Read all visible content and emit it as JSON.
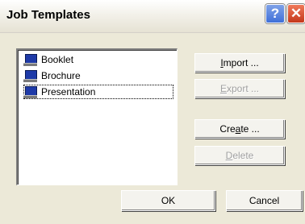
{
  "window": {
    "title": "Job Templates",
    "help_label": "?",
    "close_label": "✕"
  },
  "templates": [
    {
      "label": "Booklet",
      "icon": "computer-icon"
    },
    {
      "label": "Brochure",
      "icon": "computer-icon"
    },
    {
      "label": "Presentation",
      "icon": "computer-icon",
      "focused": true
    }
  ],
  "buttons": {
    "import": {
      "pre": "",
      "accel": "I",
      "post": "mport ...",
      "enabled": true
    },
    "export": {
      "pre": "",
      "accel": "E",
      "post": "xport ...",
      "enabled": false
    },
    "create": {
      "pre": "Cre",
      "accel": "a",
      "post": "te ...",
      "enabled": true
    },
    "delete": {
      "pre": "",
      "accel": "D",
      "post": "elete",
      "enabled": false
    },
    "ok": "OK",
    "cancel": "Cancel"
  }
}
